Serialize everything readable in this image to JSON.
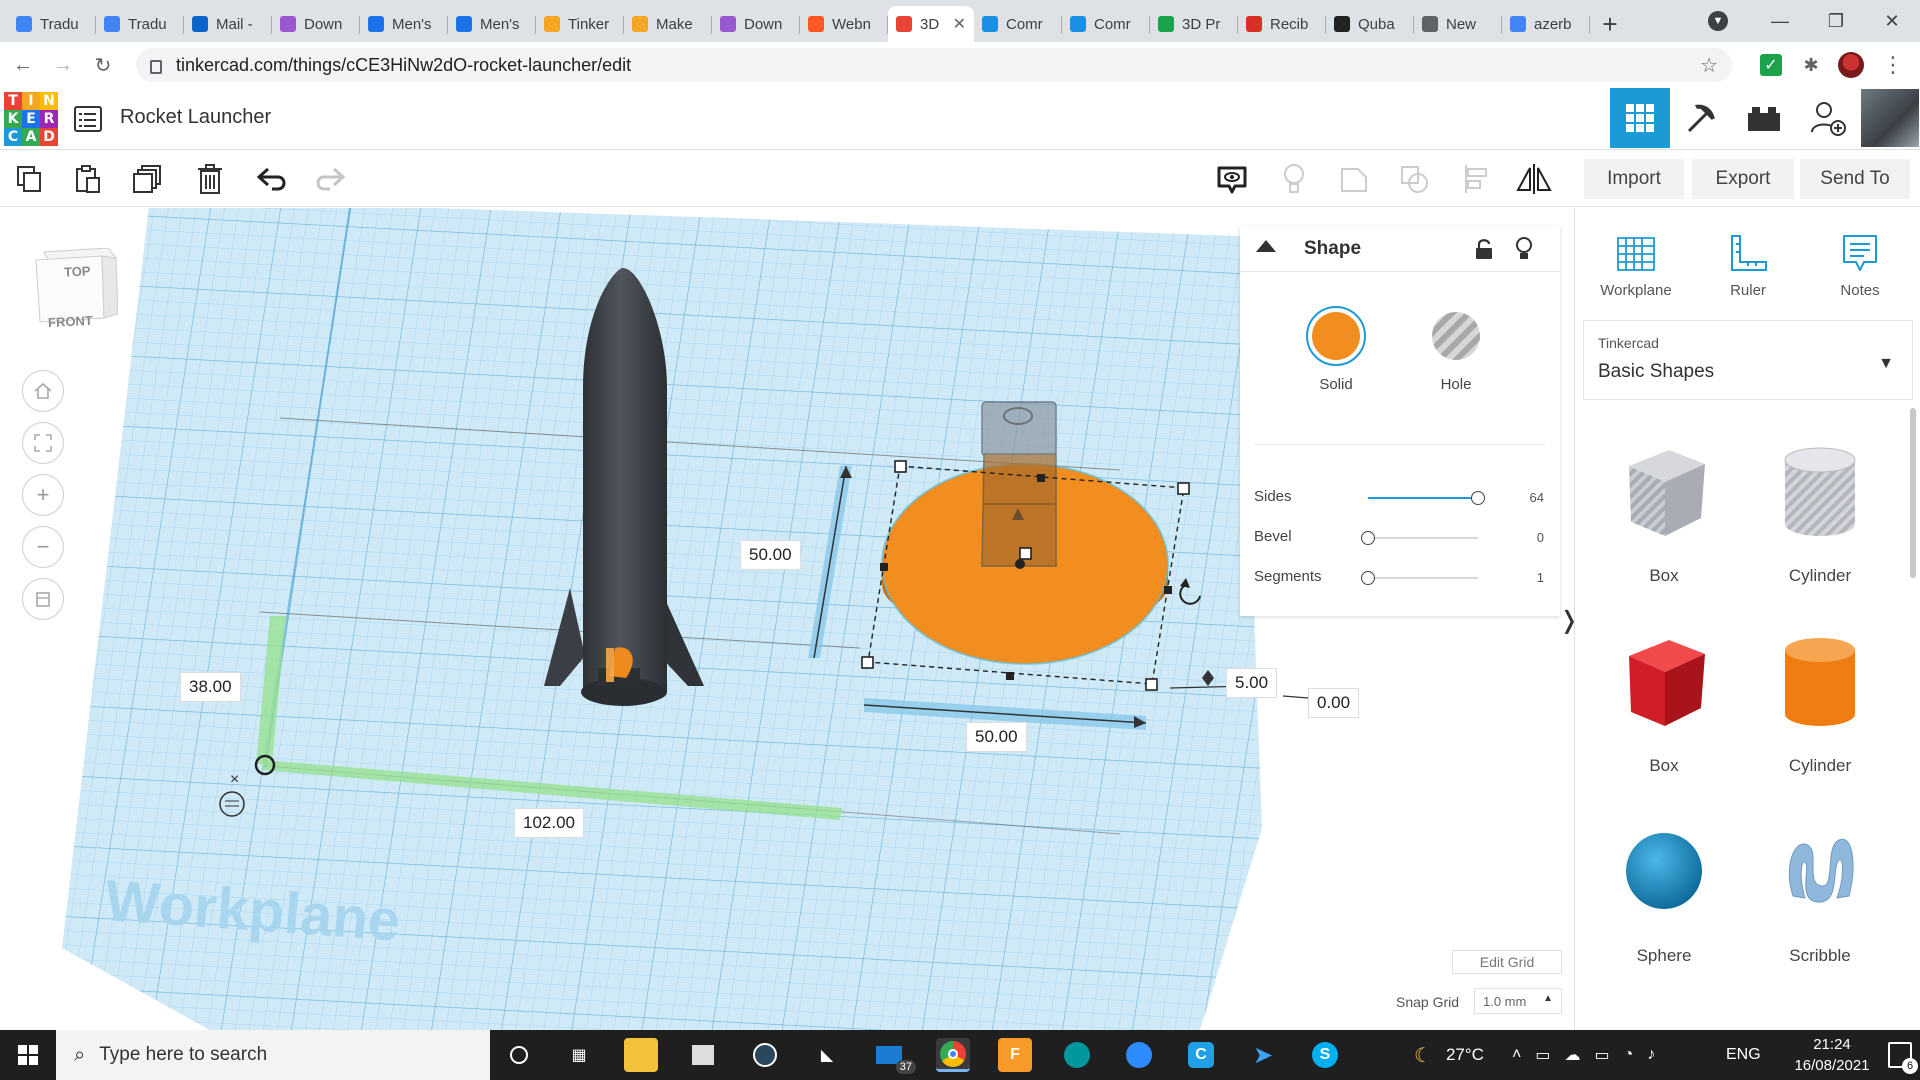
{
  "browser": {
    "tabs": [
      {
        "label": "Tradu",
        "color": "#4285f4"
      },
      {
        "label": "Tradu",
        "color": "#4285f4"
      },
      {
        "label": "Mail -",
        "color": "#0a64c8"
      },
      {
        "label": "Down",
        "color": "#9b59d0"
      },
      {
        "label": "Men's",
        "color": "#1a73e8"
      },
      {
        "label": "Men's",
        "color": "#1a73e8"
      },
      {
        "label": "Tinker",
        "color": "#f5a623"
      },
      {
        "label": "Make",
        "color": "#f5a623"
      },
      {
        "label": "Down",
        "color": "#9b59d0"
      },
      {
        "label": "Webn",
        "color": "#ff5722"
      },
      {
        "label": "3D",
        "color": "#e94335",
        "active": true
      },
      {
        "label": "Comr",
        "color": "#1a8fe3"
      },
      {
        "label": "Comr",
        "color": "#1a8fe3"
      },
      {
        "label": "3D Pr",
        "color": "#1aa34a"
      },
      {
        "label": "Recib",
        "color": "#d93025"
      },
      {
        "label": "Quba",
        "color": "#222222"
      },
      {
        "label": "New",
        "color": "#5f6368"
      },
      {
        "label": "azerb",
        "color": "#4285f4"
      }
    ],
    "url": "tinkercad.com/things/cCE3HiNw2dO-rocket-launcher/edit"
  },
  "header": {
    "logo_letters": [
      "T",
      "I",
      "N",
      "K",
      "E",
      "R",
      "C",
      "A",
      "D"
    ],
    "logo_colors": [
      "#e94335",
      "#f5a623",
      "#fbbc05",
      "#34a853",
      "#1a73e8",
      "#9c27b0",
      "#1c9ad6",
      "#34a853",
      "#e94335"
    ],
    "title": "Rocket Launcher"
  },
  "toolbar": {
    "import_label": "Import",
    "export_label": "Export",
    "sendto_label": "Send To"
  },
  "viewcube": {
    "top_label": "TOP",
    "front_label": "FRONT"
  },
  "canvas": {
    "workplane_label": "Workplane",
    "dims": {
      "height": "50.00",
      "width": "50.00",
      "depth": "5.00",
      "elevation": "0.00",
      "ruler_y": "38.00",
      "ruler_x": "102.00"
    },
    "edit_grid_label": "Edit Grid",
    "snap_grid_label": "Snap Grid",
    "snap_grid_value": "1.0 mm",
    "colors": {
      "grid_bg": "#cbe7f6",
      "grid_line": "#8ec9e8",
      "selected_shape": "#f28d20",
      "rocket": "#3c4046"
    }
  },
  "shape_panel": {
    "title": "Shape",
    "solid_label": "Solid",
    "hole_label": "Hole",
    "solid_color": "#f28d20",
    "props": [
      {
        "label": "Sides",
        "value": "64",
        "level": 1.0
      },
      {
        "label": "Bevel",
        "value": "0",
        "level": 0.0
      },
      {
        "label": "Segments",
        "value": "1",
        "level": 0.0
      }
    ]
  },
  "sidebar": {
    "tools": [
      {
        "label": "Workplane",
        "icon": "workplane-grid-icon"
      },
      {
        "label": "Ruler",
        "icon": "ruler-icon"
      },
      {
        "label": "Notes",
        "icon": "notes-icon"
      }
    ],
    "library_source": "Tinkercad",
    "library_name": "Basic Shapes",
    "shapes": [
      {
        "label": "Box",
        "kind": "box-hole",
        "color": "#b5b8bf"
      },
      {
        "label": "Cylinder",
        "kind": "cylinder-hole",
        "color": "#c8cacf"
      },
      {
        "label": "Box",
        "kind": "box",
        "color": "#e0202a"
      },
      {
        "label": "Cylinder",
        "kind": "cylinder",
        "color": "#ef7d12"
      },
      {
        "label": "Sphere",
        "kind": "sphere",
        "color": "#1b8fc9"
      },
      {
        "label": "Scribble",
        "kind": "scribble",
        "color": "#8fb8dc"
      }
    ]
  },
  "taskbar": {
    "search_placeholder": "Type here to search",
    "mail_badge": "37",
    "weather": "27°C",
    "language": "ENG",
    "time": "21:24",
    "date": "16/08/2021",
    "notifications": "6"
  }
}
